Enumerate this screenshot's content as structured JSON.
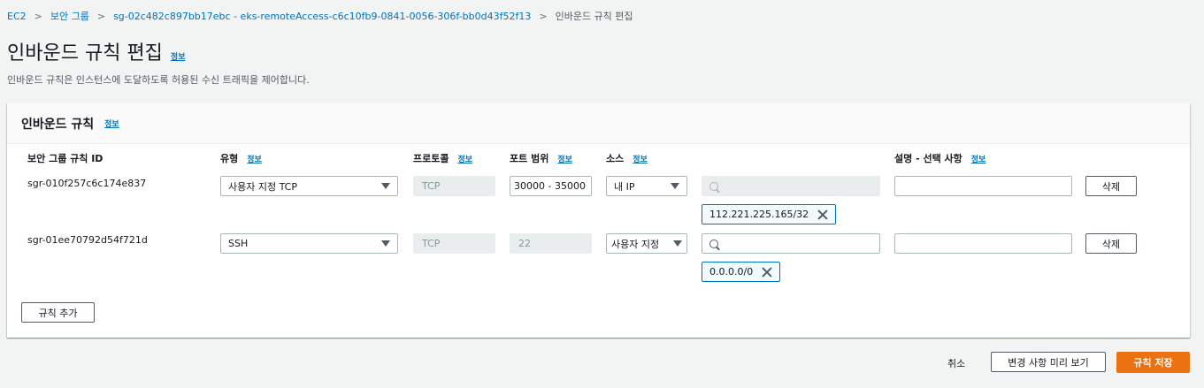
{
  "breadcrumb": {
    "items": [
      "EC2",
      "보안 그룹",
      "sg-02c482c897bb17ebc - eks-remoteAccess-c6c10fb9-0841-0056-306f-bb0d43f52f13"
    ],
    "current": "인바운드 규칙 편집"
  },
  "page": {
    "title": "인바운드 규칙 편집",
    "info": "정보",
    "description": "인바운드 규칙은 인스턴스에 도달하도록 허용된 수신 트래픽을 제어합니다."
  },
  "panel": {
    "title": "인바운드 규칙",
    "info": "정보",
    "columns": {
      "rule_id": "보안 그룹 규칙 ID",
      "type": "유형",
      "protocol": "프로토콜",
      "port_range": "포트 범위",
      "source": "소스",
      "description": "설명 - 선택 사항",
      "info": "정보"
    },
    "rules": [
      {
        "id": "sgr-010f257c6c174e837",
        "type": "사용자 지정 TCP",
        "protocol": "TCP",
        "port_range": "30000 - 35000",
        "source": "내 IP",
        "source_token": "112.221.225.165/32",
        "description": "",
        "delete_label": "삭제"
      },
      {
        "id": "sgr-01ee70792d54f721d",
        "type": "SSH",
        "protocol": "TCP",
        "port_range": "22",
        "source": "사용자 지정",
        "source_token": "0.0.0.0/0",
        "description": "",
        "delete_label": "삭제"
      }
    ],
    "add_rule_label": "규칙 추가"
  },
  "footer": {
    "cancel_label": "취소",
    "preview_label": "변경 사항 미리 보기",
    "save_label": "규칙 저장"
  },
  "colors": {
    "link": "#0073bb",
    "primary": "#ec7211",
    "background": "#f2f3f3"
  }
}
